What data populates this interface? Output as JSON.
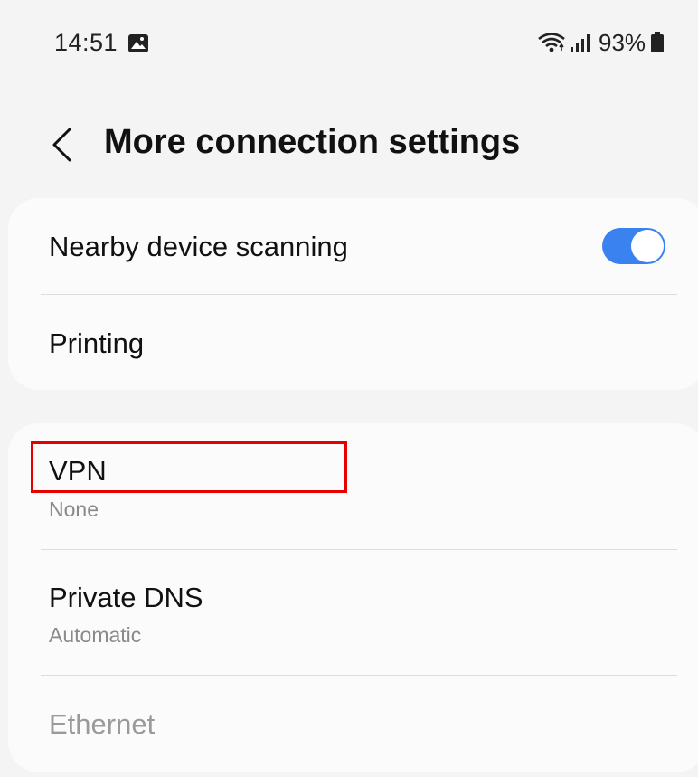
{
  "status_bar": {
    "time": "14:51",
    "battery_percent": "93%",
    "icons": [
      "gallery-icon",
      "wifi-icon",
      "signal-icon",
      "battery-icon"
    ]
  },
  "header": {
    "title": "More connection settings",
    "back_icon": "chevron-left-icon"
  },
  "groups": [
    {
      "items": [
        {
          "title": "Nearby device scanning",
          "toggle_on": true
        },
        {
          "title": "Printing"
        }
      ]
    },
    {
      "items": [
        {
          "title": "VPN",
          "subtitle": "None",
          "highlighted": true
        },
        {
          "title": "Private DNS",
          "subtitle": "Automatic"
        },
        {
          "title": "Ethernet",
          "disabled": true
        }
      ]
    }
  ],
  "colors": {
    "background": "#f4f4f4",
    "card": "#fbfbfb",
    "accent": "#3a82f0",
    "highlight": "#e60000",
    "secondary_text": "#8a8a8a"
  }
}
